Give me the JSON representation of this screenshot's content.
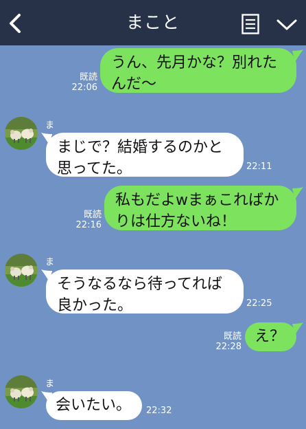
{
  "header": {
    "title": "まこと"
  },
  "colors": {
    "background": "#7192c5",
    "header": "#273248",
    "outgoing_bubble": "#7de35e",
    "incoming_bubble": "#ffffff"
  },
  "messages": [
    {
      "direction": "out",
      "text": "うん、先月かな？別れたんだ〜",
      "read": "既読",
      "time": "22:06"
    },
    {
      "direction": "in",
      "sender": "まこと",
      "text": "まじで？結婚するのかと思ってた。",
      "time": "22:11"
    },
    {
      "direction": "out",
      "text": "私もだよwまぁこればかりは仕方ないね！",
      "read": "既読",
      "time": "22:16"
    },
    {
      "direction": "in",
      "sender": "まこと",
      "text": "そうなるなら待ってれば良かった。",
      "time": "22:25"
    },
    {
      "direction": "out",
      "text": "え？",
      "read": "既読",
      "time": "22:28"
    },
    {
      "direction": "in",
      "sender": "まこと",
      "text": "会いたい。",
      "time": "22:32"
    }
  ]
}
